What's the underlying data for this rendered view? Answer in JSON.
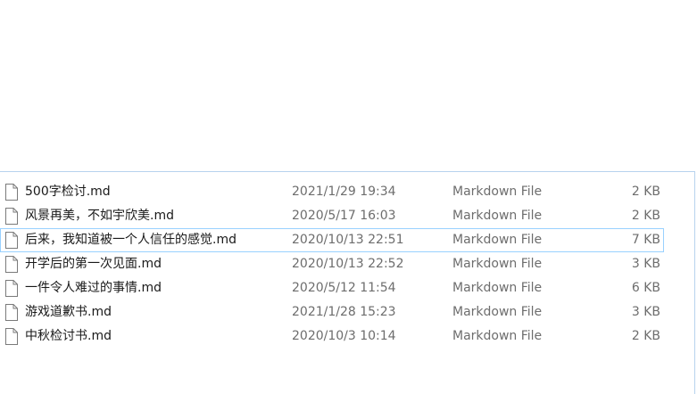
{
  "colors": {
    "selection_border": "#99d1ff",
    "pane_border": "#b7d3ee",
    "secondary_text": "#6d6d6d"
  },
  "files": [
    {
      "name": "500字检讨.md",
      "date": "2021/1/29 19:34",
      "type": "Markdown File",
      "size": "2 KB",
      "icon": "document-icon",
      "focused": false
    },
    {
      "name": "风景再美，不如宇欣美.md",
      "date": "2020/5/17 16:03",
      "type": "Markdown File",
      "size": "2 KB",
      "icon": "document-icon",
      "focused": false
    },
    {
      "name": "后来，我知道被一个人信任的感觉.md",
      "date": "2020/10/13 22:51",
      "type": "Markdown File",
      "size": "7 KB",
      "icon": "document-icon",
      "focused": true
    },
    {
      "name": "开学后的第一次见面.md",
      "date": "2020/10/13 22:52",
      "type": "Markdown File",
      "size": "3 KB",
      "icon": "document-icon",
      "focused": false
    },
    {
      "name": "一件令人难过的事情.md",
      "date": "2020/5/12 11:54",
      "type": "Markdown File",
      "size": "6 KB",
      "icon": "document-icon",
      "focused": false
    },
    {
      "name": "游戏道歉书.md",
      "date": "2021/1/28 15:23",
      "type": "Markdown File",
      "size": "3 KB",
      "icon": "document-icon",
      "focused": false
    },
    {
      "name": "中秋检讨书.md",
      "date": "2020/10/3 10:14",
      "type": "Markdown File",
      "size": "2 KB",
      "icon": "document-icon",
      "focused": false
    }
  ]
}
